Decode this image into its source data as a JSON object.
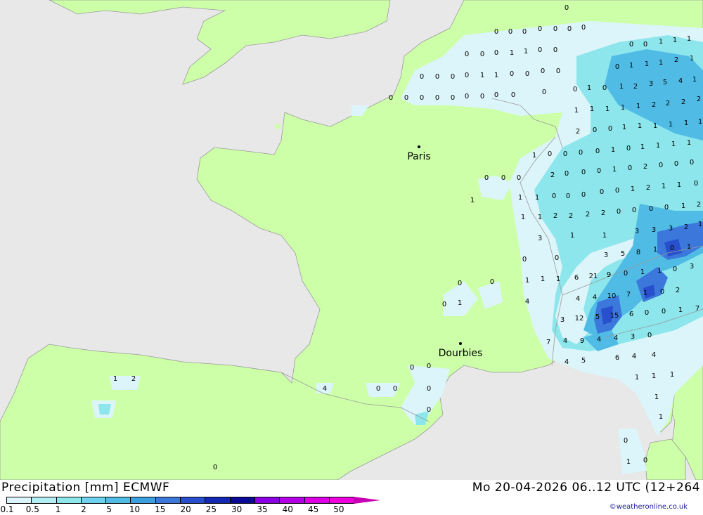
{
  "map": {
    "cities": [
      {
        "name": "Paris"
      },
      {
        "name": "Dourbies"
      }
    ],
    "precip_values": [
      "0",
      "0",
      "0",
      "0",
      "0",
      "0",
      "0",
      "0",
      "0",
      "0",
      "0",
      "1",
      "1",
      "0",
      "0",
      "0",
      "0",
      "0",
      "0",
      "1",
      "1",
      "0",
      "0",
      "0",
      "0",
      "0",
      "0",
      "0",
      "0",
      "0",
      "0",
      "0",
      "0",
      "0",
      "0",
      "0",
      "0",
      "1",
      "1",
      "1",
      "0",
      "1",
      "1",
      "1",
      "2",
      "1",
      "0",
      "1",
      "0",
      "1",
      "2",
      "3",
      "5",
      "4",
      "1",
      "1",
      "1",
      "1",
      "1",
      "1",
      "2",
      "2",
      "2",
      "2",
      "2",
      "0",
      "0",
      "1",
      "1",
      "1",
      "1",
      "1",
      "1",
      "1",
      "0",
      "0",
      "0",
      "0",
      "1",
      "0",
      "1",
      "1",
      "1",
      "1",
      "2",
      "0",
      "0",
      "0",
      "1",
      "0",
      "2",
      "0",
      "0",
      "0",
      "1",
      "1",
      "1",
      "0",
      "0",
      "0",
      "0",
      "0",
      "1",
      "2",
      "1",
      "1",
      "0",
      "1",
      "1",
      "2",
      "2",
      "2",
      "2",
      "0",
      "0",
      "0",
      "0",
      "1",
      "2",
      "3",
      "1",
      "1",
      "3",
      "3",
      "3",
      "2",
      "1",
      "0",
      "0",
      "3",
      "5",
      "8",
      "1",
      "0",
      "1",
      "1",
      "1",
      "1",
      "6",
      "21",
      "9",
      "0",
      "1",
      "1",
      "0",
      "3",
      "4",
      "4",
      "4",
      "10",
      "7",
      "1",
      "0",
      "2",
      "3",
      "12",
      "5",
      "15",
      "6",
      "0",
      "0",
      "1",
      "7",
      "7",
      "4",
      "9",
      "4",
      "4",
      "3",
      "0",
      "4",
      "5",
      "6",
      "4",
      "4",
      "1",
      "1",
      "1",
      "1",
      "1",
      "1",
      "2",
      "0",
      "0",
      "4",
      "0",
      "0",
      "0",
      "0",
      "0",
      "0",
      "0",
      "1",
      "0",
      "0",
      "0",
      "0",
      "0",
      "1",
      "0",
      "0",
      "1",
      "0"
    ]
  },
  "footer": {
    "title_left": "Precipitation [mm] ECMWF",
    "title_right": "Mo 20-04-2026 06..12 UTC (12+264",
    "credit": "©weatheronline.co.uk",
    "legend": {
      "labels": [
        "0.1",
        "0.5",
        "1",
        "2",
        "5",
        "10",
        "15",
        "20",
        "25",
        "30",
        "35",
        "40",
        "45",
        "50"
      ],
      "colors": [
        "#dcf5fa",
        "#b4eef5",
        "#8ce6eb",
        "#6ed2ee",
        "#50bce6",
        "#3ca0e0",
        "#3c78dc",
        "#2850cc",
        "#1428b4",
        "#0a0a96",
        "#8c00e6",
        "#b400e6",
        "#dc00e6",
        "#f000dc",
        "#c800b4"
      ]
    }
  }
}
